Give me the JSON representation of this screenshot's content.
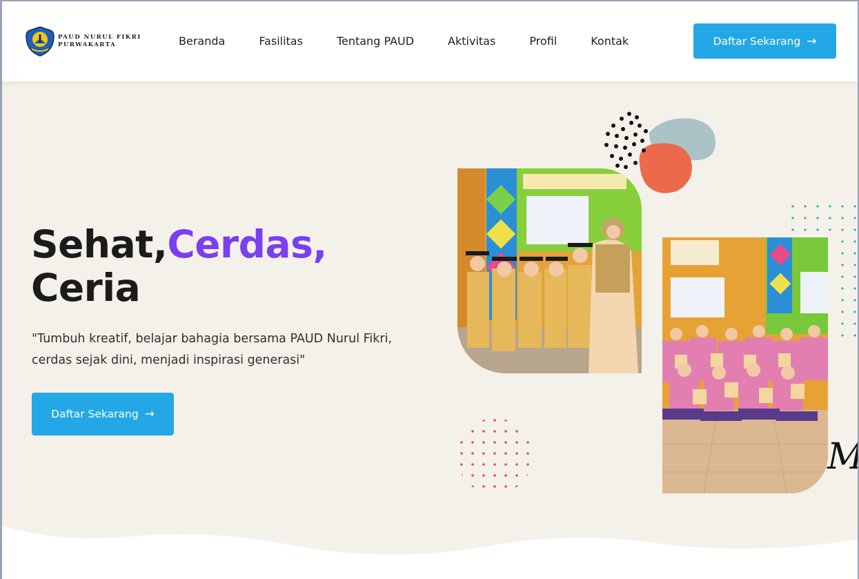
{
  "brand": {
    "line1": "PAUD NURUL FIKRI",
    "line2": "PURWAKARTA"
  },
  "nav": {
    "items": [
      {
        "label": "Beranda"
      },
      {
        "label": "Fasilitas"
      },
      {
        "label": "Tentang PAUD"
      },
      {
        "label": "Aktivitas"
      },
      {
        "label": "Profil"
      },
      {
        "label": "Kontak"
      }
    ],
    "cta_label": "Daftar Sekarang",
    "cta_icon": "arrow-right-icon"
  },
  "hero": {
    "headline_part1": "Sehat,",
    "headline_accent": "Cerdas,",
    "headline_part2": "Ceria",
    "quote": "\"Tumbuh kreatif, belajar bahagia bersama PAUD Nurul Fikri, cerdas sejak dini, menjadi inspirasi generasi\"",
    "cta_label": "Daftar Sekarang"
  },
  "colors": {
    "accent_blue": "#23a7e6",
    "accent_purple": "#7a3ff0",
    "hero_bg": "#f4f1ea",
    "coral": "#ec6a4c",
    "teal_dots": "#2bb39a",
    "red_dots": "#e8475e",
    "blob_gray": "#a9c3c6"
  }
}
